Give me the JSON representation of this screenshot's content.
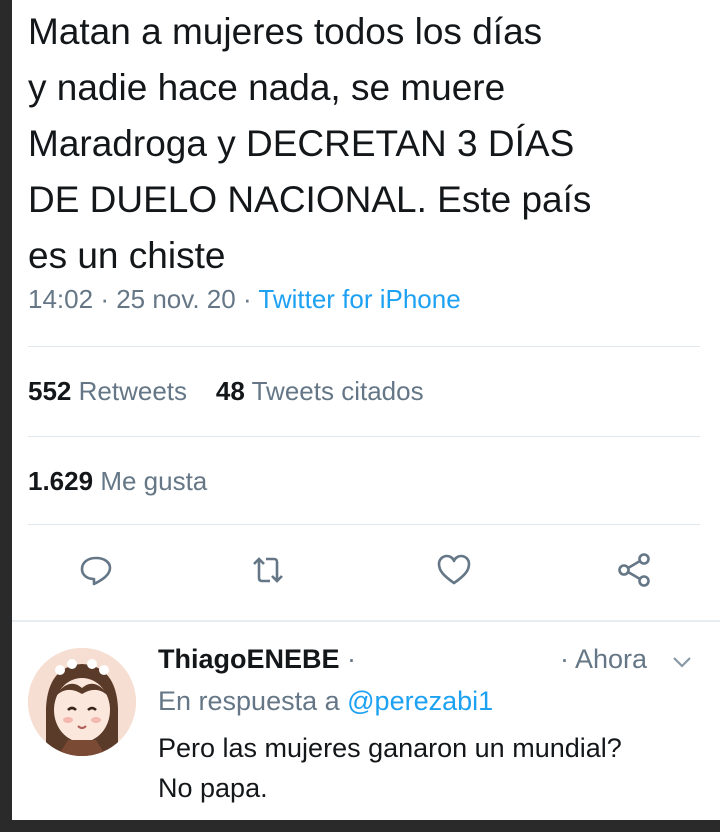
{
  "tweet": {
    "lines": [
      "Matan a mujeres todos los días",
      "y nadie hace nada, se muere",
      "Maradroga y DECRETAN 3 DÍAS",
      "DE DUELO NACIONAL. Este país",
      "es un chiste"
    ],
    "time": "14:02",
    "date": "25 nov. 20",
    "source": "Twitter for iPhone"
  },
  "stats": {
    "retweets_count": "552",
    "retweets_label": "Retweets",
    "quotes_count": "48",
    "quotes_label": "Tweets citados",
    "likes_count": "1.629",
    "likes_label": "Me gusta"
  },
  "actions": [
    "reply-icon",
    "retweet-icon",
    "like-icon",
    "share-icon"
  ],
  "reply": {
    "name": "ThiagoENEBE",
    "time": "Ahora",
    "reply_prefix": "En respuesta a",
    "reply_handle": "@perezabi1",
    "lines": [
      "Pero las mujeres ganaron un mundial?",
      "No papa."
    ]
  },
  "colors": {
    "text": "#14171a",
    "secondary": "#657786",
    "link": "#1da1f2",
    "divider": "#e1e8ed"
  }
}
